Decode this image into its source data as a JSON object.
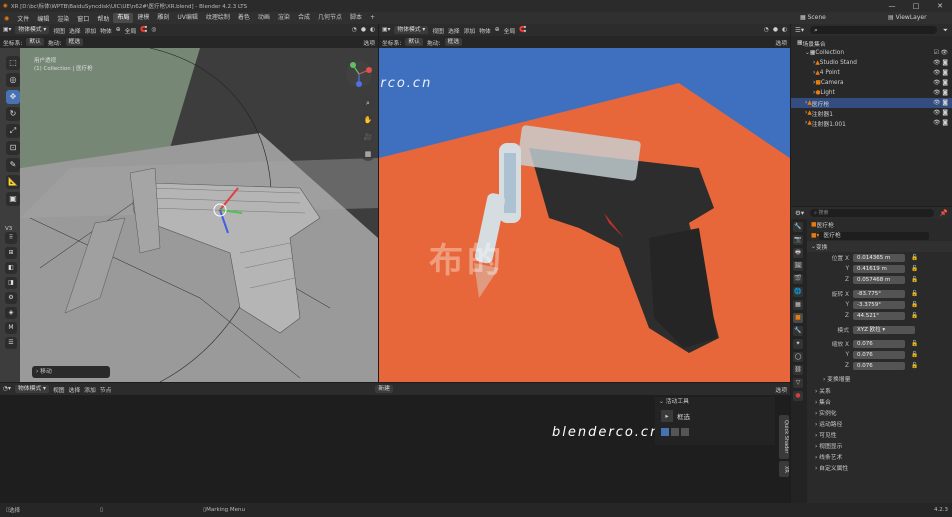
{
  "window": {
    "title": "XR [D:\\bc\\标体\\WPTB\\BaiduSyncdisk\\UIC\\UE\\n62#\\医疗枪\\XR.blend] - Blender 4.2.3 LTS",
    "btn_min": "—",
    "btn_max": "□",
    "btn_close": "✕"
  },
  "menu": {
    "items": [
      "文件",
      "编辑",
      "渲染",
      "窗口",
      "帮助"
    ],
    "workspaces": [
      "布局",
      "建模",
      "雕刻",
      "UV编辑",
      "纹理绘制",
      "着色",
      "动画",
      "渲染",
      "合成",
      "几何节点",
      "脚本"
    ],
    "active": "布局",
    "plus": "+",
    "scene": "Scene",
    "view_layer": "ViewLayer"
  },
  "left_vp": {
    "mode": "物体模式",
    "menus": [
      "视图",
      "选择",
      "添加",
      "物体"
    ],
    "global": "全局",
    "coord_label": "坐标系:",
    "coord_value": "默认",
    "drag_label": "拖动:",
    "drag_value": "框选",
    "options": "选项",
    "info_line1": "用户透视",
    "info_line2": "(1) Collection | 医疗枪",
    "operator": "移动",
    "side_label": "V3"
  },
  "right_vp": {
    "mode": "物体模式",
    "menus": [
      "视图",
      "选择",
      "添加",
      "物体"
    ],
    "global": "全局",
    "coord_label": "坐标系:",
    "coord_value": "默认",
    "drag_label": "拖动:",
    "drag_value": "框选",
    "options": "选项",
    "watermark_url": "blenderco.cn",
    "watermark_cn": "布的"
  },
  "bottom_ed": {
    "mode": "物体模式",
    "menus": [
      "视图",
      "选择",
      "添加",
      "节点"
    ],
    "new_label": "新建",
    "options": "选项",
    "watermark_url": "blenderco.cn",
    "active_tool_title": "活动工具",
    "active_tool_name": "框选",
    "vtabs": [
      "Quick Shader",
      "XR"
    ]
  },
  "outliner": {
    "search_placeholder": "",
    "root": "场景集合",
    "rows": [
      {
        "label": "Collection",
        "indent": 1
      },
      {
        "label": "Studio Stand",
        "indent": 2
      },
      {
        "label": "4 Point",
        "indent": 2
      },
      {
        "label": "Camera",
        "indent": 2
      },
      {
        "label": "Light",
        "indent": 2
      },
      {
        "label": "医疗枪",
        "indent": 1
      },
      {
        "label": "注射器1",
        "indent": 1
      },
      {
        "label": "注射器1.001",
        "indent": 1
      }
    ],
    "selected": "医疗枪"
  },
  "props": {
    "search_placeholder": "搜索",
    "object_path": "医疗枪",
    "object_name": "医疗枪",
    "section_transform": "变换",
    "location_label": "位置 X",
    "loc": [
      "0.014365 m",
      "0.41619 m",
      "0.057468 m"
    ],
    "rotation_label": "旋转 X",
    "rot": [
      "-83.775°",
      "-3.3759°",
      "44.521°"
    ],
    "mode_label": "模式",
    "mode_value": "XYZ 欧拉",
    "scale_label": "缩放 X",
    "scale": [
      "0.076",
      "0.076",
      "0.076"
    ],
    "axis_y": "Y",
    "axis_z": "Z",
    "delta": "变换增量",
    "sections": [
      "关系",
      "集合",
      "实例化",
      "运动路径",
      "可见性",
      "视图显示",
      "线条艺术",
      "自定义属性"
    ]
  },
  "status": {
    "select": "选择",
    "menu": "Marking Menu",
    "version": "4.2.3"
  },
  "colors": {
    "accent": "#4772b3",
    "orange_bg": "#e8673a",
    "blue_bg": "#3f6fbf",
    "viewport_grey": "#9a9a9a"
  }
}
